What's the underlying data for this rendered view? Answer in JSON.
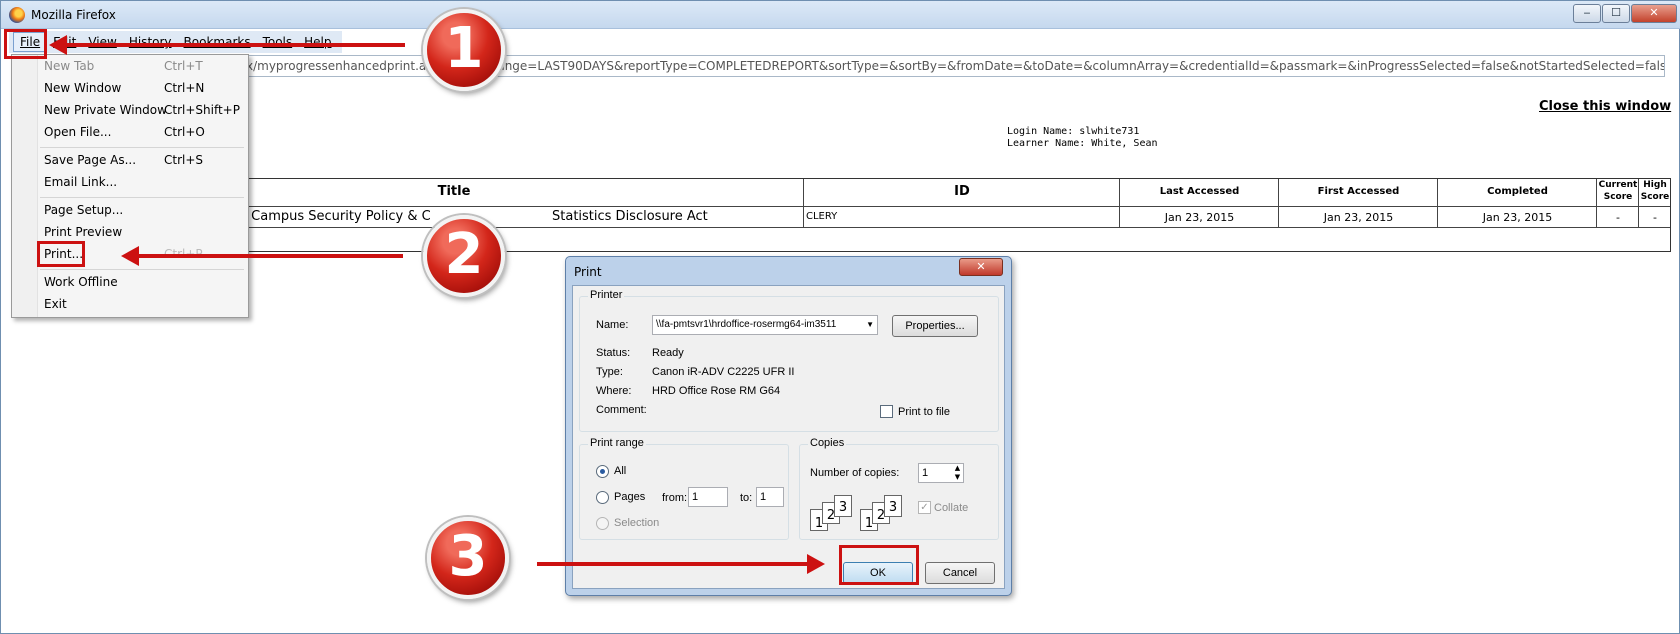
{
  "window": {
    "title": "Mozilla Firefox",
    "minimize": "‒",
    "maximize": "☐",
    "close": "✕"
  },
  "menubar": {
    "items": [
      "File",
      "Edit",
      "View",
      "History",
      "Bookmarks",
      "Tools",
      "Help"
    ]
  },
  "urlbar": {
    "value": "x/myprogressenhancedprint.action?dateRange=LAST90DAYS&reportType=COMPLETEDREPORT&sortType=&sortBy=&fromDate=&toDate=&columnArray=&credentialId=&passmark=&inProgressSelected=false&notStartedSelected=false&completSelecte"
  },
  "page": {
    "close_link": "Close this window",
    "login_name": "Login Name: slwhite731",
    "learner_name": "Learner Name: White, Sean",
    "table": {
      "headers": {
        "title": "Title",
        "id": "ID",
        "last_accessed": "Last Accessed",
        "first_accessed": "First Accessed",
        "completed": "Completed",
        "current_score": "Current Score",
        "high_score": "High Score"
      },
      "row": {
        "title": "ry Campus Security Policy & C",
        "title_tail": "Statistics Disclosure Act",
        "id": "CLERY",
        "last_accessed": "Jan 23, 2015",
        "first_accessed": "Jan 23, 2015",
        "completed": "Jan 23, 2015",
        "current_score": "-",
        "high_score": "-"
      }
    }
  },
  "file_menu": {
    "items": [
      {
        "label": "New Tab",
        "shortcut": "Ctrl+T",
        "disabled": true
      },
      {
        "label": "New Window",
        "shortcut": "Ctrl+N"
      },
      {
        "label": "New Private Window",
        "shortcut": "Ctrl+Shift+P"
      },
      {
        "label": "Open File...",
        "shortcut": "Ctrl+O"
      },
      {
        "label": "Save Page As...",
        "shortcut": "Ctrl+S"
      },
      {
        "label": "Email Link..."
      },
      {
        "label": "Page Setup..."
      },
      {
        "label": "Print Preview"
      },
      {
        "label": "Print...",
        "shortcut": "Ctrl+P"
      },
      {
        "label": "Work Offline"
      },
      {
        "label": "Exit"
      }
    ]
  },
  "print_dialog": {
    "title": "Print",
    "close": "✕",
    "printer_group": "Printer",
    "name_label": "Name:",
    "name_value": "\\\\fa-pmtsvr1\\hrdoffice-rosermg64-im3511",
    "properties": "Properties...",
    "status_label": "Status:",
    "status_value": "Ready",
    "type_label": "Type:",
    "type_value": "Canon iR-ADV C2225 UFR II",
    "where_label": "Where:",
    "where_value": "HRD Office Rose RM G64",
    "comment_label": "Comment:",
    "print_to_file": "Print to file",
    "range_group": "Print range",
    "all": "All",
    "pages": "Pages",
    "from_label": "from:",
    "from_value": "1",
    "to_label": "to:",
    "to_value": "1",
    "selection": "Selection",
    "copies_group": "Copies",
    "num_copies_label": "Number of copies:",
    "num_copies_value": "1",
    "collate": "Collate",
    "collate_glyph": "✓",
    "ok": "OK",
    "cancel": "Cancel",
    "collate_icon_numbers": [
      "1",
      "2",
      "3",
      "1",
      "2",
      "3"
    ]
  },
  "callouts": [
    "1",
    "2",
    "3"
  ],
  "colors": {
    "accent_red": "#cc1111",
    "dialog_frame": "#bcd1ea"
  }
}
